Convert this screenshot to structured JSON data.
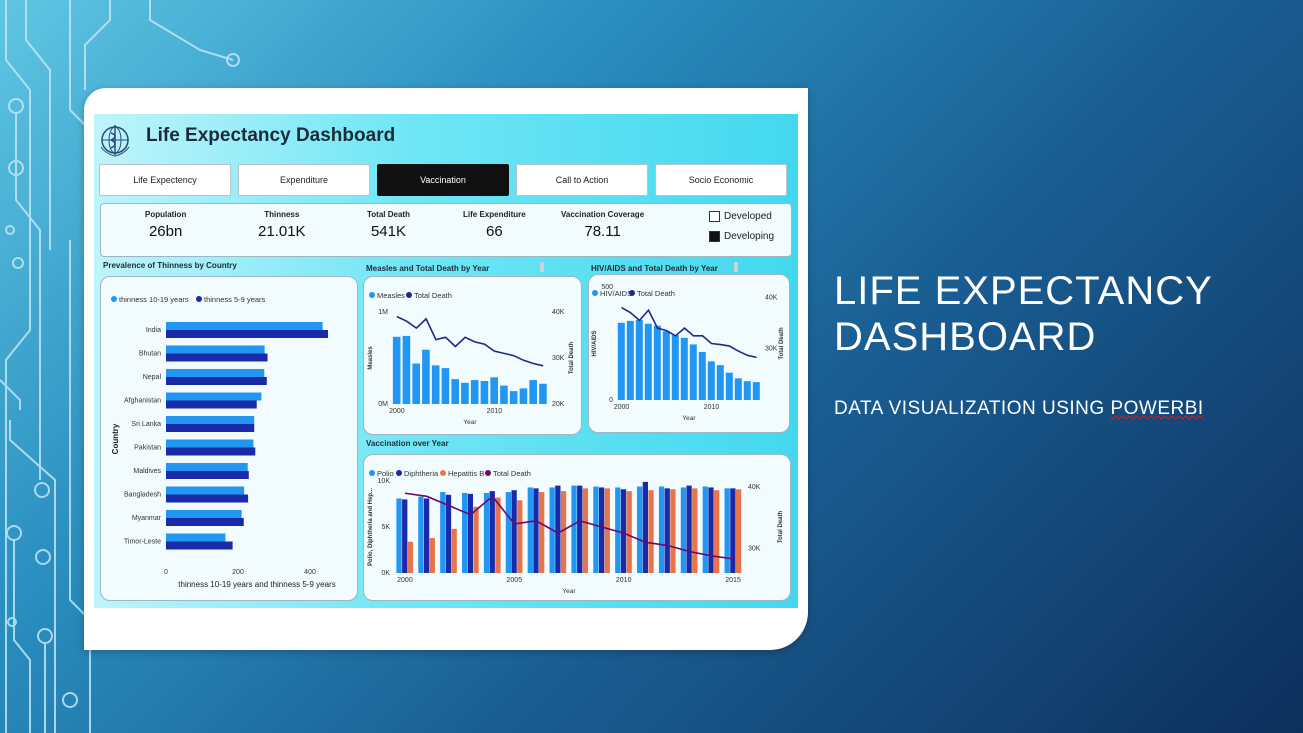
{
  "slide": {
    "title_line1": "Life Expectancy",
    "title_line2": "Dashboard",
    "subtitle_pre": "Data visualization using ",
    "subtitle_word": "PowerBI"
  },
  "dashboard": {
    "title": "Life Expectancy Dashboard",
    "nav": [
      {
        "label": "Life Expectency",
        "active": false
      },
      {
        "label": "Expenditure",
        "active": false
      },
      {
        "label": "Vaccination",
        "active": true
      },
      {
        "label": "Call to Action",
        "active": false
      },
      {
        "label": "Socio Economic",
        "active": false
      }
    ],
    "kpis": [
      {
        "label": "Population",
        "value": "26bn"
      },
      {
        "label": "Thinness",
        "value": "21.01K"
      },
      {
        "label": "Total Death",
        "value": "541K"
      },
      {
        "label": "Life Expenditure",
        "value": "66"
      },
      {
        "label": "Vaccination Coverage",
        "value": "78.11"
      }
    ],
    "status_filter": [
      {
        "label": "Developed",
        "checked": false
      },
      {
        "label": "Developing",
        "checked": true
      }
    ]
  },
  "colors": {
    "light_blue": "#2196f3",
    "dark_blue": "#1a2aa8",
    "orange": "#e8744a",
    "purple": "#6a0a6a",
    "line_navy": "#1c2a8a"
  },
  "chart_data": [
    {
      "id": "thinness",
      "type": "bar",
      "orientation": "horizontal",
      "title": "Prevalence of Thinness by Country",
      "xlabel": "thinness 10-19 years and thinness 5-9 years",
      "ylabel": "Country",
      "categories": [
        "India",
        "Bhutan",
        "Nepal",
        "Afghanistan",
        "Sri Lanka",
        "Pakistan",
        "Maldives",
        "Bangladesh",
        "Myanmar",
        "Timor-Leste"
      ],
      "series": [
        {
          "name": "thinness  10-19 years",
          "values": [
            435,
            274,
            273,
            265,
            245,
            243,
            227,
            217,
            210,
            165
          ]
        },
        {
          "name": "thinness 5-9 years",
          "values": [
            450,
            282,
            280,
            252,
            245,
            248,
            230,
            228,
            216,
            185
          ]
        }
      ],
      "xlim": [
        0,
        500
      ],
      "xticks": [
        0,
        200,
        400
      ]
    },
    {
      "id": "measles",
      "type": "bar+line",
      "title": "Measles and Total Death by Year",
      "xlabel": "Year",
      "ylabel": "Measles",
      "y2label": "Total Death",
      "x": [
        2000,
        2001,
        2002,
        2003,
        2004,
        2005,
        2006,
        2007,
        2008,
        2009,
        2010,
        2011,
        2012,
        2013,
        2014,
        2015
      ],
      "series": [
        {
          "name": "Measles",
          "kind": "bar",
          "values": [
            730000,
            740000,
            440000,
            590000,
            420000,
            390000,
            270000,
            230000,
            260000,
            250000,
            290000,
            200000,
            140000,
            170000,
            260000,
            220000
          ]
        },
        {
          "name": "Total Death",
          "kind": "line",
          "values": [
            39000,
            38000,
            36500,
            38500,
            34000,
            34500,
            32500,
            34500,
            33500,
            33000,
            31500,
            31000,
            30500,
            29500,
            28800,
            28300
          ]
        }
      ],
      "ylim": [
        0,
        1000000
      ],
      "y2lim": [
        20000,
        40000
      ],
      "yticks": [
        "0M",
        "1M"
      ],
      "y2ticks": [
        "20K",
        "30K",
        "40K"
      ],
      "xticks": [
        2000,
        2010
      ]
    },
    {
      "id": "hiv",
      "type": "bar+line",
      "title": "HIV/AIDS and Total Death by Year",
      "xlabel": "Year",
      "ylabel": "HIV/AIDS",
      "y2label": "Total Death",
      "x": [
        2000,
        2001,
        2002,
        2003,
        2004,
        2005,
        2006,
        2007,
        2008,
        2009,
        2010,
        2011,
        2012,
        2013,
        2014,
        2015
      ],
      "series": [
        {
          "name": "HIV/AIDS",
          "kind": "bar",
          "values": [
            410,
            420,
            425,
            405,
            395,
            365,
            345,
            330,
            295,
            255,
            205,
            185,
            145,
            115,
            100,
            95
          ]
        },
        {
          "name": "Total Death",
          "kind": "line",
          "values": [
            38000,
            37000,
            35500,
            37500,
            34000,
            33500,
            32500,
            34000,
            32500,
            32500,
            31000,
            30800,
            30500,
            29500,
            28700,
            28300
          ]
        }
      ],
      "ylim": [
        0,
        600
      ],
      "y2lim": [
        20000,
        42000
      ],
      "yticks": [
        "0",
        "500"
      ],
      "y2ticks": [
        "30K",
        "40K"
      ],
      "xticks": [
        2000,
        2010
      ]
    },
    {
      "id": "vaccination",
      "type": "bar+line",
      "title": "Vaccination over Year",
      "xlabel": "Year",
      "ylabel": "Polio, Diphtheria and Hep...",
      "y2label": "Total Death",
      "x": [
        2000,
        2001,
        2002,
        2003,
        2004,
        2005,
        2006,
        2007,
        2008,
        2009,
        2010,
        2011,
        2012,
        2013,
        2014,
        2015
      ],
      "series": [
        {
          "name": "Polio",
          "kind": "bar",
          "values": [
            8100,
            8300,
            8800,
            8700,
            8700,
            8800,
            9300,
            9300,
            9500,
            9400,
            9300,
            9400,
            9400,
            9300,
            9400,
            9200
          ]
        },
        {
          "name": "Diphtheria",
          "kind": "bar",
          "values": [
            8000,
            8100,
            8500,
            8600,
            8900,
            9000,
            9200,
            9500,
            9500,
            9300,
            9100,
            9900,
            9200,
            9500,
            9300,
            9200
          ]
        },
        {
          "name": "Hepatitis B",
          "kind": "bar",
          "values": [
            3400,
            3800,
            4800,
            7200,
            8200,
            7900,
            8800,
            8900,
            9200,
            9200,
            8900,
            9000,
            9100,
            9200,
            9000,
            9100
          ]
        },
        {
          "name": "Total Death",
          "kind": "line",
          "values": [
            39000,
            38500,
            37000,
            35500,
            38500,
            34000,
            34500,
            32500,
            34500,
            33500,
            32500,
            31000,
            30500,
            29500,
            28800,
            28300
          ]
        }
      ],
      "ylim": [
        0,
        10000
      ],
      "y2lim": [
        26000,
        41000
      ],
      "yticks": [
        "0K",
        "5K",
        "10K"
      ],
      "y2ticks": [
        "30K",
        "40K"
      ],
      "xticks": [
        2000,
        2005,
        2010,
        2015
      ]
    }
  ]
}
